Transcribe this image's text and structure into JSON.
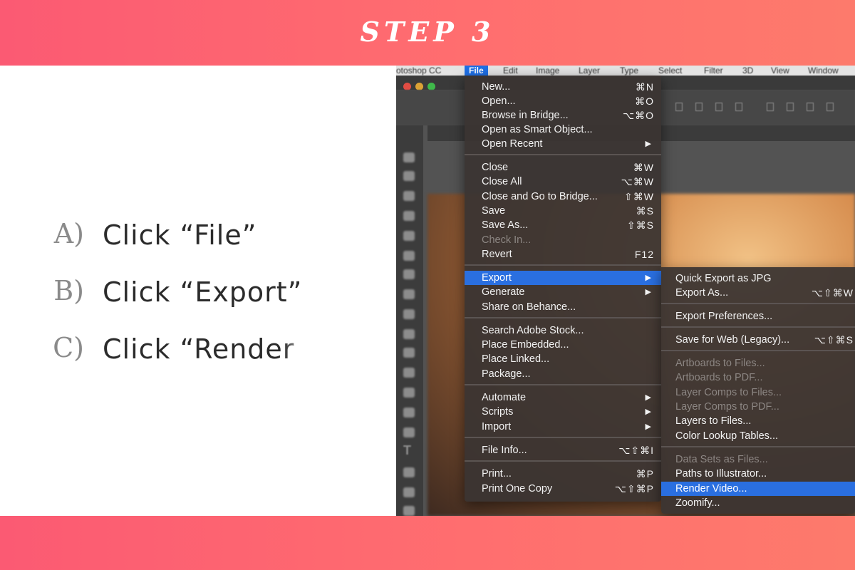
{
  "header": {
    "title": "STEP 3"
  },
  "instructions": [
    {
      "letter": "A)",
      "text": "Click “File”"
    },
    {
      "letter": "B)",
      "text": "Click “Export”"
    },
    {
      "letter": "C)",
      "text": "Click “Render"
    }
  ],
  "menubar": {
    "app": "otoshop CC",
    "items": [
      "File",
      "Edit",
      "Image",
      "Layer",
      "Type",
      "Select",
      "Filter",
      "3D",
      "View",
      "Window"
    ]
  },
  "file_menu": {
    "items": [
      {
        "label": "New...",
        "shortcut": "⌘N"
      },
      {
        "label": "Open...",
        "shortcut": "⌘O"
      },
      {
        "label": "Browse in Bridge...",
        "shortcut": "⌥⌘O"
      },
      {
        "label": "Open as Smart Object...",
        "shortcut": ""
      },
      {
        "label": "Open Recent",
        "shortcut": "▶"
      },
      {
        "label": "Close",
        "shortcut": "⌘W"
      },
      {
        "label": "Close All",
        "shortcut": "⌥⌘W"
      },
      {
        "label": "Close and Go to Bridge...",
        "shortcut": "⇧⌘W"
      },
      {
        "label": "Save",
        "shortcut": "⌘S"
      },
      {
        "label": "Save As...",
        "shortcut": "⇧⌘S"
      },
      {
        "label": "Check In...",
        "shortcut": ""
      },
      {
        "label": "Revert",
        "shortcut": "F12"
      },
      {
        "label": "Export",
        "shortcut": "▶"
      },
      {
        "label": "Generate",
        "shortcut": "▶"
      },
      {
        "label": "Share on Behance...",
        "shortcut": ""
      },
      {
        "label": "Search Adobe Stock...",
        "shortcut": ""
      },
      {
        "label": "Place Embedded...",
        "shortcut": ""
      },
      {
        "label": "Place Linked...",
        "shortcut": ""
      },
      {
        "label": "Package...",
        "shortcut": ""
      },
      {
        "label": "Automate",
        "shortcut": "▶"
      },
      {
        "label": "Scripts",
        "shortcut": "▶"
      },
      {
        "label": "Import",
        "shortcut": "▶"
      },
      {
        "label": "File Info...",
        "shortcut": "⌥⇧⌘I"
      },
      {
        "label": "Print...",
        "shortcut": "⌘P"
      },
      {
        "label": "Print One Copy",
        "shortcut": "⌥⇧⌘P"
      }
    ]
  },
  "export_submenu": {
    "items": [
      {
        "label": "Quick Export as JPG",
        "shortcut": ""
      },
      {
        "label": "Export As...",
        "shortcut": "⌥⇧⌘W"
      },
      {
        "label": "Export Preferences...",
        "shortcut": ""
      },
      {
        "label": "Save for Web (Legacy)...",
        "shortcut": "⌥⇧⌘S"
      },
      {
        "label": "Artboards to Files...",
        "shortcut": ""
      },
      {
        "label": "Artboards to PDF...",
        "shortcut": ""
      },
      {
        "label": "Layer Comps to Files...",
        "shortcut": ""
      },
      {
        "label": "Layer Comps to PDF...",
        "shortcut": ""
      },
      {
        "label": "Layers to Files...",
        "shortcut": ""
      },
      {
        "label": "Color Lookup Tables...",
        "shortcut": ""
      },
      {
        "label": "Data Sets as Files...",
        "shortcut": ""
      },
      {
        "label": "Paths to Illustrator...",
        "shortcut": ""
      },
      {
        "label": "Render Video...",
        "shortcut": ""
      },
      {
        "label": "Zoomify...",
        "shortcut": ""
      }
    ]
  },
  "colors": {
    "banner": "#fb5a73",
    "highlight": "#2a6fe0",
    "menu_bg": "#3a3432"
  },
  "icons": [
    "move-tool-icon",
    "marquee-tool-icon",
    "lasso-tool-icon",
    "crop-tool-icon",
    "brush-tool-icon",
    "type-tool-icon",
    "hand-tool-icon"
  ]
}
